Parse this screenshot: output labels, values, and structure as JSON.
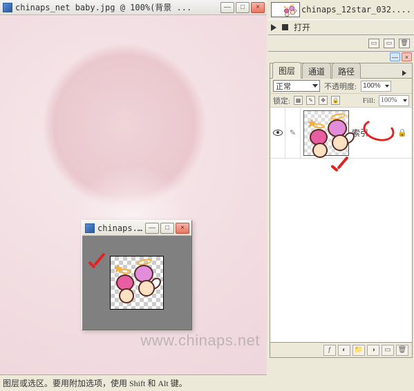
{
  "main_window": {
    "title": "chinaps_net baby.jpg @ 100%(背景 ...",
    "watermark": "www.chinaps.net",
    "statusbar": "图层或选区。要用附加选项，使用 Shift 和 Alt 键。"
  },
  "sub_window": {
    "title": "chinaps..."
  },
  "top_strip": {
    "file_name": "chinaps_12star_032....",
    "action_label": "打开"
  },
  "layers_panel": {
    "tabs": {
      "layers": "图层",
      "channels": "通道",
      "paths": "路径"
    },
    "blend_mode": "正常",
    "opacity_label": "不透明度:",
    "opacity_value": "100%",
    "lock_label": "锁定:",
    "fill_label": "Fill:",
    "fill_value": "100%",
    "layer": {
      "name": "索引"
    }
  },
  "icons": {
    "minimize": "—",
    "maximize": "□",
    "close": "×",
    "menu_tri": "▶",
    "lock": "🔒",
    "brush": "✎",
    "trash": "🗑",
    "new": "▭",
    "folder": "📁",
    "fx": "ƒ",
    "mask": "◐",
    "adjust": "◑",
    "checker": "▦"
  }
}
